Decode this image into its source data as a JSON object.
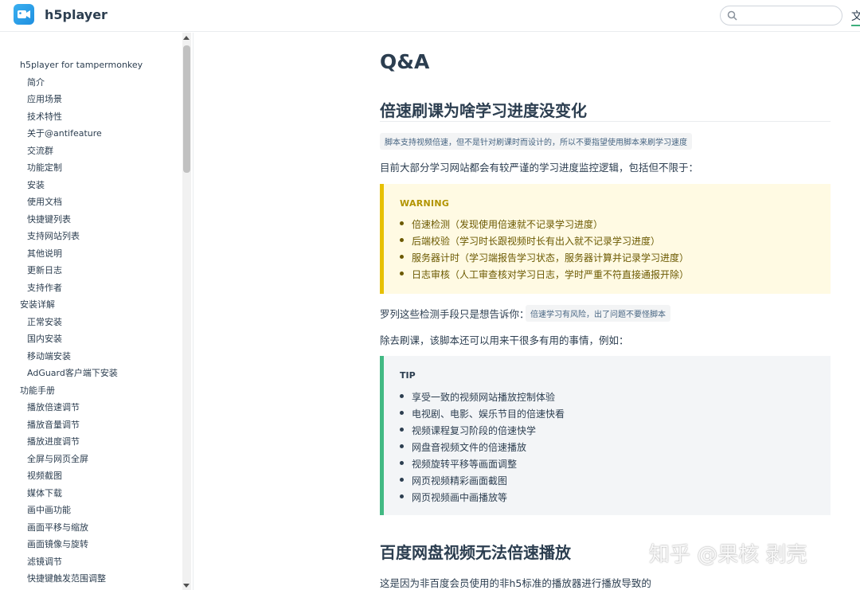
{
  "header": {
    "site_name": "h5player",
    "search_placeholder": "",
    "lang_label": "文"
  },
  "sidebar": {
    "items": [
      {
        "label": "h5player for tampermonkey",
        "level": "group"
      },
      {
        "label": "简介",
        "level": "child"
      },
      {
        "label": "应用场景",
        "level": "child"
      },
      {
        "label": "技术特性",
        "level": "child"
      },
      {
        "label": "关于@antifeature",
        "level": "child"
      },
      {
        "label": "交流群",
        "level": "child"
      },
      {
        "label": "功能定制",
        "level": "child"
      },
      {
        "label": "安装",
        "level": "child"
      },
      {
        "label": "使用文档",
        "level": "child"
      },
      {
        "label": "快捷键列表",
        "level": "child"
      },
      {
        "label": "支持网站列表",
        "level": "child"
      },
      {
        "label": "其他说明",
        "level": "child"
      },
      {
        "label": "更新日志",
        "level": "child"
      },
      {
        "label": "支持作者",
        "level": "child"
      },
      {
        "label": "安装详解",
        "level": "group"
      },
      {
        "label": "正常安装",
        "level": "child"
      },
      {
        "label": "国内安装",
        "level": "child"
      },
      {
        "label": "移动端安装",
        "level": "child"
      },
      {
        "label": "AdGuard客户端下安装",
        "level": "child"
      },
      {
        "label": "功能手册",
        "level": "group"
      },
      {
        "label": "播放倍速调节",
        "level": "child"
      },
      {
        "label": "播放音量调节",
        "level": "child"
      },
      {
        "label": "播放进度调节",
        "level": "child"
      },
      {
        "label": "全屏与网页全屏",
        "level": "child"
      },
      {
        "label": "视频截图",
        "level": "child"
      },
      {
        "label": "媒体下载",
        "level": "child"
      },
      {
        "label": "画中画功能",
        "level": "child"
      },
      {
        "label": "画面平移与缩放",
        "level": "child"
      },
      {
        "label": "画面镜像与旋转",
        "level": "child"
      },
      {
        "label": "滤镜调节",
        "level": "child"
      },
      {
        "label": "快捷键触发范围调整",
        "level": "child"
      }
    ]
  },
  "main": {
    "page_title": "Q&A",
    "section1": {
      "heading": "倍速刷课为啥学习进度没变化",
      "code_note": "脚本支持视频倍速，但不是针对刷课时而设计的，所以不要指望使用脚本来刷学习速度",
      "intro": "目前大部分学习网站都会有较严谨的学习进度监控逻辑，包括但不限于：",
      "warning": {
        "title": "WARNING",
        "items": [
          "倍速检测（发现使用倍速就不记录学习进度）",
          "后端校验（学习时长跟视频时长有出入就不记录学习进度）",
          "服务器计时（学习端报告学习状态，服务器计算并记录学习进度）",
          "日志审核（人工审查核对学习日志，学时严重不符直接通报开除）"
        ]
      },
      "conclusion_prefix": "罗列这些检测手段只是想告诉你：",
      "conclusion_code": "倍速学习有风险，出了问题不要怪脚本",
      "other_uses": "除去刷课，该脚本还可以用来干很多有用的事情，例如：",
      "tip": {
        "title": "TIP",
        "items": [
          "享受一致的视频网站播放控制体验",
          "电视剧、电影、娱乐节目的倍速快看",
          "视频课程复习阶段的倍速快学",
          "网盘音视频文件的倍速播放",
          "视频旋转平移等画面调整",
          "网页视频精彩画面截图",
          "网页视频画中画播放等"
        ]
      }
    },
    "section2": {
      "heading": "百度网盘视频无法倍速播放",
      "text": "这是因为非百度会员使用的非h5标准的播放器进行播放导致的"
    }
  },
  "watermark": "知乎 @果核 剥壳"
}
